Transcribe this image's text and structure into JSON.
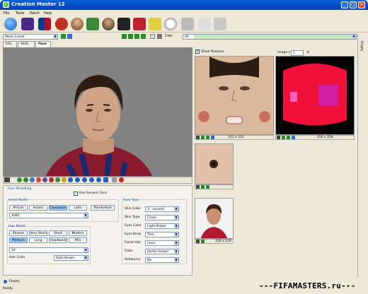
{
  "window": {
    "title": "Creation Master 12"
  },
  "menu": [
    "File",
    "Tools",
    "Patch",
    "Help"
  ],
  "toolbar2": {
    "player": "Messi Lionel",
    "filter_label": "Filter",
    "filter_value": "All"
  },
  "tabs": [
    "Info",
    "Skills",
    "Face"
  ],
  "face_panel": {
    "title": "Face Modelling",
    "generic_face": "Has Generic Face",
    "head_model_label": "Head Model",
    "head_buttons": [
      "African",
      "Asiatic",
      "Caucasian",
      "Latin"
    ],
    "head_selected": "Caucasian",
    "randomize": "Randomize",
    "head_id": "2085",
    "hair_model_label": "Hair Model",
    "hair_buttons": [
      "Shaven",
      "Very Short",
      "Short",
      "Modern",
      "Medium",
      "Long",
      "Headband",
      "Afro"
    ],
    "hair_selected": "Medium",
    "hair_id": "16",
    "hair_color_label": "Hair Color",
    "hair_color": "Dark Brown",
    "face_type_label": "Face Type",
    "fields": [
      {
        "label": "Skin Color",
        "value": "3 - unused"
      },
      {
        "label": "Skin Type",
        "value": "Clean"
      },
      {
        "label": "Eyes Color",
        "value": "Light Brown"
      },
      {
        "label": "Eyes Brow",
        "value": "Thin"
      },
      {
        "label": "Facial Hair",
        "value": "none"
      },
      {
        "label": "Color",
        "value": "darker brown"
      },
      {
        "label": "Sideburns",
        "value": "No"
      }
    ]
  },
  "textures": {
    "show_label": "Show Textures",
    "image_n_label": "Image n.",
    "image_n": "1",
    "image_total": "/2",
    "size1": "512 x 512",
    "size2": "256 x 256",
    "size3": "128 x 128"
  },
  "status": {
    "empty_top": "Empty",
    "empty": "Empty",
    "ready": "Ready",
    "side": "Empty"
  },
  "watermark": "---FIFAMASTERS.ru---"
}
